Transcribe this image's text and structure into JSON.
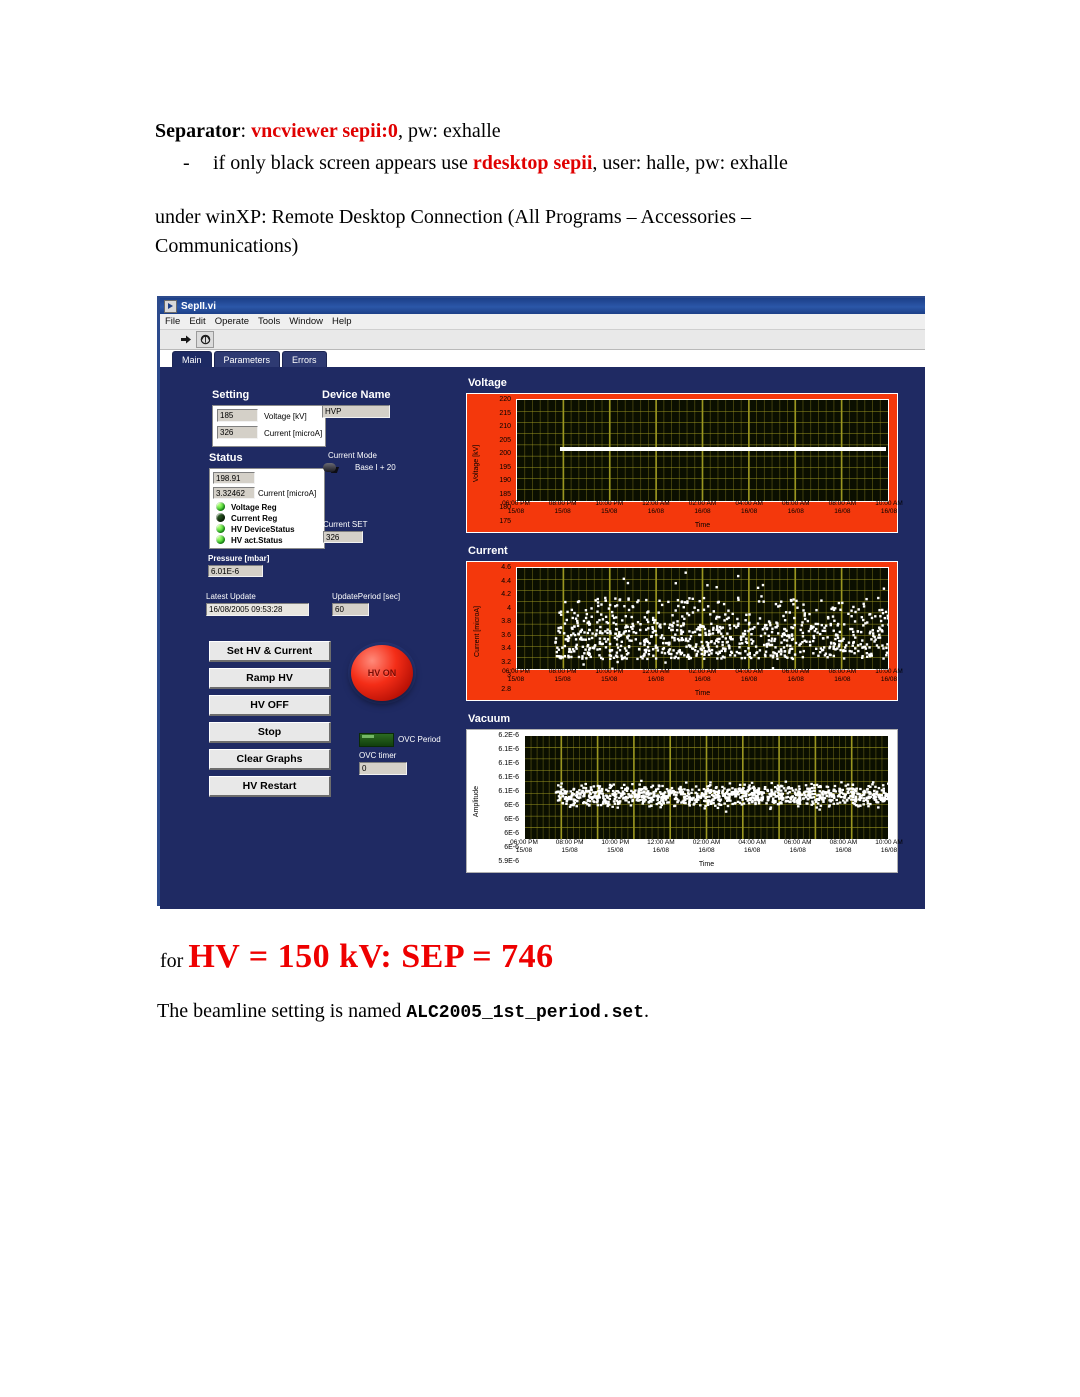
{
  "document": {
    "sep_label": "Separator",
    "sep_colon": ": ",
    "sep_cmd": "vncviewer sepii:0",
    "sep_tail": ", pw: exhalle",
    "bullet_dash": "-",
    "bullet_pre": "if only black screen appears use ",
    "bullet_cmd": "rdesktop sepii",
    "bullet_tail": ", user: halle, pw: exhalle",
    "winxp_para": "under winXP: Remote Desktop Connection (All Programs – Accessories – Communications)",
    "hv_prefix": "for ",
    "hv_headline": "HV = 150 kV: SEP = 746",
    "beamline_pre": "The beamline setting is named ",
    "beamline_file": "ALC2005_1st_period.set",
    "beamline_post": "."
  },
  "app": {
    "title": "SepII.vi",
    "menu": [
      "File",
      "Edit",
      "Operate",
      "Tools",
      "Window",
      "Help"
    ],
    "toolbar": [
      {
        "name": "run-arrow-icon",
        "glyph": "➡"
      },
      {
        "name": "run-continuous-icon",
        "glyph": "↺"
      }
    ],
    "tabs": [
      {
        "label": "Main",
        "active": true
      },
      {
        "label": "Parameters",
        "active": false
      },
      {
        "label": "Errors",
        "active": false
      }
    ]
  },
  "panel": {
    "setting": {
      "title": "Setting",
      "rows": [
        {
          "value": "185",
          "label": "Voltage [kV]"
        },
        {
          "value": "326",
          "label": "Current [microA]"
        }
      ]
    },
    "device_name": {
      "title": "Device Name",
      "value": "HVP"
    },
    "status": {
      "title": "Status",
      "voltage_value": "198.91",
      "current_value": "3.32462",
      "current_label": "Current [microA]",
      "leds": [
        {
          "label": "Voltage Reg",
          "state": "on"
        },
        {
          "label": "Current Reg",
          "state": "off"
        },
        {
          "label": "HV DeviceStatus",
          "state": "on"
        },
        {
          "label": "HV act.Status",
          "state": "on"
        }
      ]
    },
    "current_mode": {
      "title": "Current Mode",
      "value": "Base I + 20"
    },
    "current_set": {
      "title": "Current SET",
      "value": "326"
    },
    "pressure": {
      "title": "Pressure [mbar]",
      "value": "6.01E-6"
    },
    "latest_update": {
      "title": "Latest Update",
      "value": "16/08/2005 09:53:28"
    },
    "update_period": {
      "title": "UpdatePeriod [sec]",
      "value": "60"
    },
    "buttons": [
      "Set HV & Current",
      "Ramp HV",
      "HV OFF",
      "Stop",
      "Clear Graphs",
      "HV Restart"
    ],
    "hv_on_label": "HV ON",
    "ovc_period_label": "OVC Period",
    "ovc_timer_label": "OVC timer",
    "ovc_timer_value": "0"
  },
  "colors": {
    "panel_bg": "#1f2a63",
    "chart_red": "#f4380c",
    "plot_bg": "#0b0f00",
    "grid": "#9a9620",
    "trace_white": "#ffffff",
    "led_on": "#2ad222",
    "led_off": "#0d2a0a",
    "hv_button": "#f42d17",
    "accent_red": "#ee0000"
  },
  "chart_data": [
    {
      "type": "line",
      "title": "Voltage",
      "ylabel": "Voltage [kV]",
      "xlabel": "Time",
      "ylim": [
        175,
        220
      ],
      "yticks": [
        220,
        215,
        210,
        205,
        200,
        195,
        190,
        185,
        180,
        175
      ],
      "xticks": [
        "06:00 PM|15/08",
        "08:00 PM|15/08",
        "10:00 PM|15/08",
        "12:00 AM|16/08",
        "02:00 AM|16/08",
        "04:00 AM|16/08",
        "06:00 AM|16/08",
        "08:00 AM|16/08",
        "10:00 AM|16/08"
      ],
      "grid": true,
      "series": [
        {
          "name": "Voltage",
          "comment": "flat trace at ~198.9 kV starting approx 07:40 PM 15/08 running to end",
          "x_start_frac": 0.115,
          "values_const": 198.9
        }
      ]
    },
    {
      "type": "scatter",
      "title": "Current",
      "ylabel": "Current [microA]",
      "xlabel": "Time",
      "ylim": [
        2.8,
        4.6
      ],
      "yticks": [
        4.6,
        4.4,
        4.2,
        4,
        3.8,
        3.6,
        3.4,
        3.2,
        3,
        2.8
      ],
      "xticks": [
        "06:00 PM|15/08",
        "08:00 PM|15/08",
        "10:00 PM|15/08",
        "12:00 AM|16/08",
        "02:00 AM|16/08",
        "04:00 AM|16/08",
        "06:00 AM|16/08",
        "08:00 AM|16/08",
        "10:00 AM|16/08"
      ],
      "grid": true,
      "distribution": {
        "center": 3.3,
        "dense_band": [
          3.0,
          3.65
        ],
        "outlier_range": [
          2.8,
          4.55
        ],
        "n_points": 900,
        "x_start_frac": 0.1
      }
    },
    {
      "type": "scatter",
      "title": "Vacuum",
      "ylabel": "Amplitude",
      "xlabel": "Time",
      "ylim": [
        5.9e-06,
        6.2e-06
      ],
      "yticks": [
        "6.2E-6",
        "6.1E-6",
        "6.1E-6",
        "6.1E-6",
        "6.1E-6",
        "6E-6",
        "6E-6",
        "6E-6",
        "6E-6",
        "5.9E-6"
      ],
      "xticks": [
        "06:00 PM|15/08",
        "08:00 PM|15/08",
        "10:00 PM|15/08",
        "12:00 AM|16/08",
        "02:00 AM|16/08",
        "04:00 AM|16/08",
        "06:00 AM|16/08",
        "08:00 AM|16/08",
        "10:00 AM|16/08"
      ],
      "grid": true,
      "distribution": {
        "center": 6.03e-06,
        "spread": 3.5e-08,
        "n_points": 1100,
        "x_start_frac": 0.08
      }
    }
  ]
}
